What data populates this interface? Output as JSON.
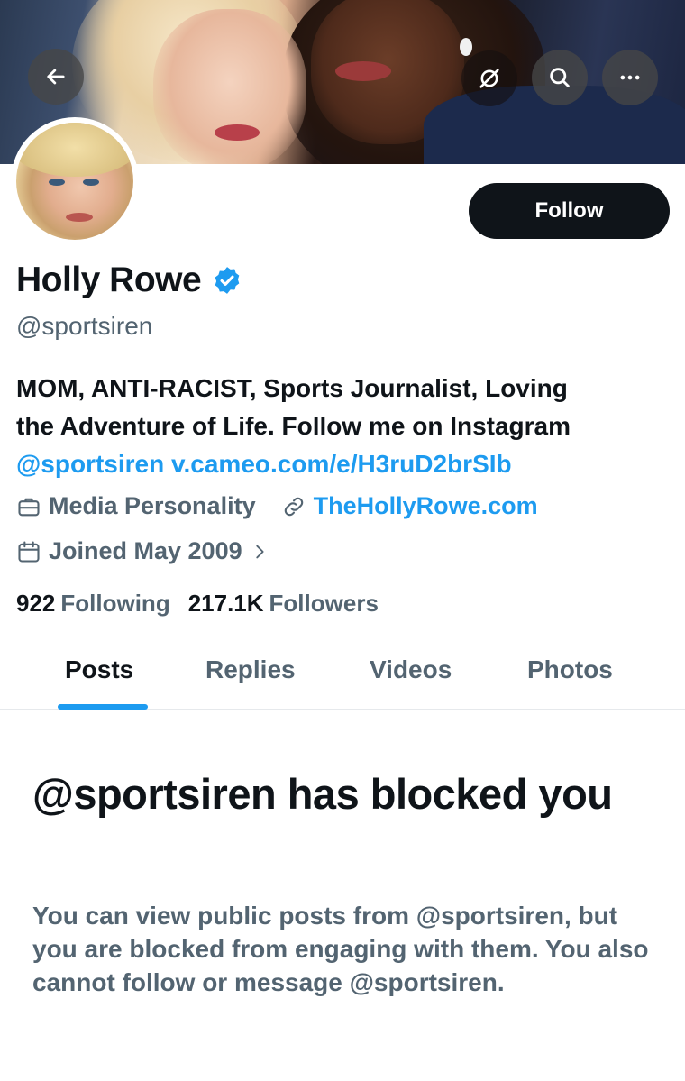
{
  "header": {
    "back_icon": "arrow-left-icon",
    "grok_icon": "grok-icon",
    "search_icon": "search-icon",
    "more_icon": "more-horizontal-icon"
  },
  "profile": {
    "display_name": "Holly Rowe",
    "verified": true,
    "handle": "@sportsiren",
    "follow_label": "Follow",
    "bio_line1": "MOM, ANTI-RACIST, Sports Journalist, Loving",
    "bio_line2": "the Adventure of Life. Follow me on Instagram",
    "bio_mention": "@sportsiren",
    "bio_url": "v.cameo.com/e/H3ruD2brSIb",
    "category": "Media Personality",
    "website": "TheHollyRowe.com",
    "joined": "Joined May 2009",
    "following_count": "922",
    "following_label": "Following",
    "followers_count": "217.1K",
    "followers_label": "Followers"
  },
  "tabs": [
    {
      "label": "Posts",
      "active": true
    },
    {
      "label": "Replies",
      "active": false
    },
    {
      "label": "Videos",
      "active": false
    },
    {
      "label": "Photos",
      "active": false
    }
  ],
  "blocked": {
    "title": "@sportsiren has blocked you",
    "description": "You can view public posts from @sportsiren, but you are blocked from engaging with them. You also cannot follow or message @sportsiren."
  },
  "colors": {
    "accent": "#1d9bf0",
    "text_primary": "#0f1419",
    "text_secondary": "#536471",
    "button_bg": "#0f1419"
  }
}
